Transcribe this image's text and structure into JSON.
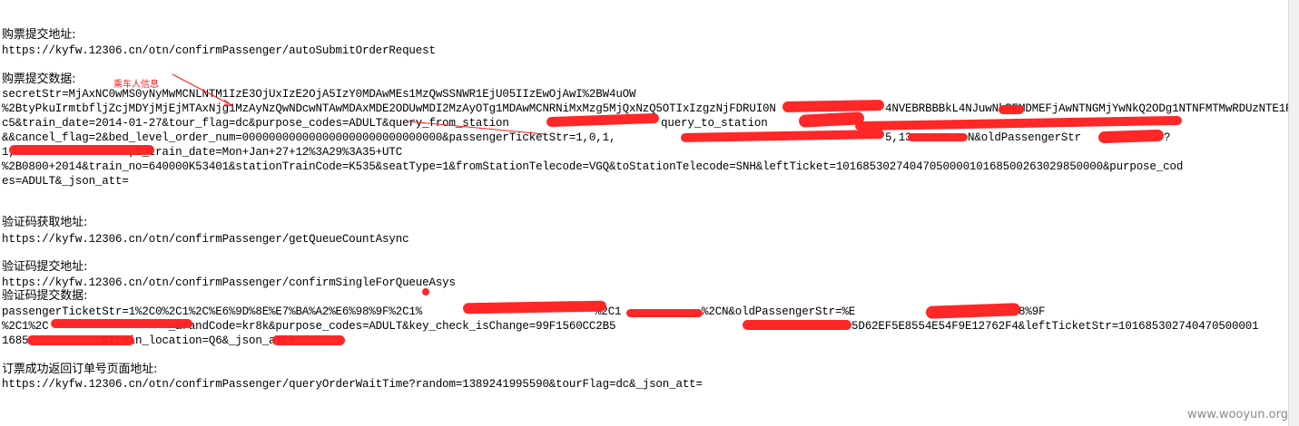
{
  "blocks": [
    {
      "heading": "购票提交地址:",
      "lines": [
        "https://kyfw.12306.cn/otn/confirmPassenger/autoSubmitOrderRequest"
      ]
    },
    {
      "heading": "购票提交数据:",
      "lines": [
        "secretStr=MjAxNC0wMS0yNyMwMCNLNTM1IzE3OjUxIzE2OjA5IzY0MDAwMEs1MzQwSSNWR1EjU05IIzEwOjAwI%2BW4uOW",
        "%2BtyPkuIrmtbfljZcjMDYjMjEjMTAxNjg1MzAyNzQwNDcwNTAwMDAxMDE2ODUwMDI2MzAyOTg1MDAwMCNRNiMxMzg5MjQxNzQ5OTIxIzgzNjFDRUI0N",
        "c5&train_date=2014-01-27&tour_flag=dc&purpose_codes=ADULT&query_from_station",
        "&&cancel_flag=2&bed_level_order_num=000000000000000000000000000000&passengerTicketStr=1,0,1,",
        "1,                 ,1_train_date=Mon+Jan+27+12%3A29%3A35+UTC",
        "%2B0800+2014&train_no=640000K53401&stationTrainCode=K535&seatType=1&fromStationTelecode=VGQ&toStationTelecode=SNH&leftTicket=1016853027404705000010168500263029850000&purpose_cod",
        "es=ADULT&_json_att="
      ]
    },
    {
      "heading": "验证码获取地址:",
      "lines": [
        "https://kyfw.12306.cn/otn/confirmPassenger/getQueueCountAsync"
      ]
    },
    {
      "heading": "验证码提交地址:",
      "lines": [
        "https://kyfw.12306.cn/otn/confirmPassenger/confirmSingleForQueueAsys"
      ]
    },
    {
      "heading": "验证码提交数据:",
      "lines": [
        "passengerTicketStr=1%2C0%2C1%2C%E6%9D%8E%E7%BA%A2%E6%98%9F%2C1%",
        "%2C1%2C                  _&randCode=kr8k&purpose_codes=ADULT&key_check_isChange=99F1560CC2B5",
        "               &train_location=Q6&_json_att="
      ]
    },
    {
      "heading": "订票成功返回订单号页面地址:",
      "lines": [
        "https://kyfw.12306.cn/otn/confirmPassenger/queryOrderWaitTime?random=1389241995590&tourFlag=dc&_json_att="
      ]
    }
  ],
  "visible_fragments": {
    "line2_tail": "4NVEBRBBBkL4NJuwNkPEMDMEFjAwNTNGMjYwNkQ2ODg1NTNFMTMwRDUzNTE1RT",
    "line3_tail": "query_to_station",
    "line4_tail_a": "5,13",
    "line4_tail_b": "N&oldPassengerStr",
    "line4_tail_c": "?",
    "line11_tail_a": "%2C1",
    "line11_tail_b": "%2CN&oldPassengerStr=%E",
    "line11_tail_c": "8%9F",
    "line12_tail_a": "5D62EF5E8554E54F9E12762F4&leftTicketStr=101685302740470500001",
    "line13_head": "1685"
  },
  "annotation": {
    "label": "乘车人信息",
    "color": "#ff1a1a"
  },
  "watermark": "www.wooyun.org",
  "colors": {
    "background": "#ffffff",
    "text": "#000000",
    "redaction": "#ff1e1e",
    "annotation": "#ff1a1a",
    "watermark": "#8a8a8a"
  }
}
